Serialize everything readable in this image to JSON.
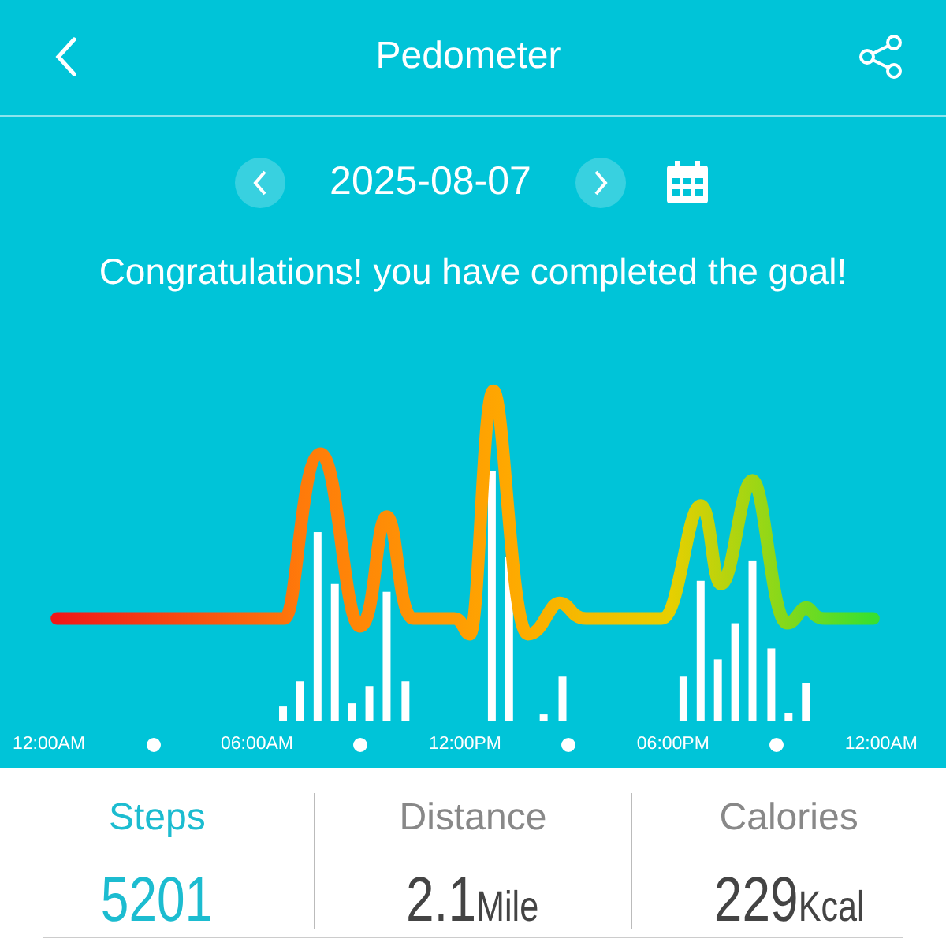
{
  "header": {
    "title": "Pedometer"
  },
  "date_nav": {
    "date": "2025-08-07"
  },
  "message": "Congratulations! you have completed the goal!",
  "chart": {
    "axis_labels": [
      "12:00AM",
      "06:00AM",
      "12:00PM",
      "06:00PM",
      "12:00AM"
    ]
  },
  "stats": [
    {
      "label": "Steps",
      "value": "5201",
      "selected": true
    },
    {
      "label": "Distance",
      "value": "2.1",
      "unit": "Mile",
      "selected": false
    },
    {
      "label": "Calories",
      "value": "229",
      "unit": "Kcal",
      "selected": false
    }
  ]
}
